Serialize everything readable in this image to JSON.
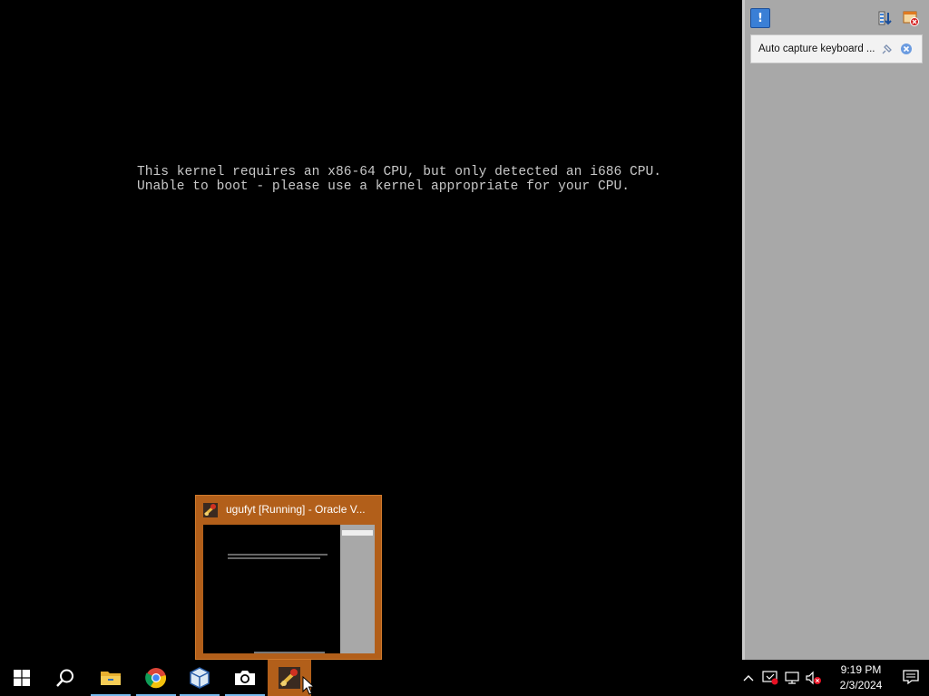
{
  "console": {
    "line1": "This kernel requires an x86-64 CPU, but only detected an i686 CPU.",
    "line2": "Unable to boot - please use a kernel appropriate for your CPU."
  },
  "side_panel": {
    "icons": [
      "info-icon",
      "collapse-all-icon",
      "close-all-icon"
    ],
    "notification": {
      "text": "Auto capture keyboard ...",
      "icons": [
        "pin-icon",
        "close-icon"
      ]
    }
  },
  "preview": {
    "title": "ugufyt [Running] - Oracle V...",
    "icon": "virtualbox-vm-icon"
  },
  "taskbar": {
    "buttons": [
      {
        "name": "start",
        "icon": "windows-logo-icon"
      },
      {
        "name": "search",
        "icon": "search-icon"
      },
      {
        "name": "file-explorer",
        "icon": "folder-icon"
      },
      {
        "name": "chrome",
        "icon": "chrome-icon"
      },
      {
        "name": "virtualbox",
        "icon": "virtualbox-icon"
      },
      {
        "name": "camera",
        "icon": "camera-icon"
      },
      {
        "name": "vm-window",
        "icon": "virtualbox-vm-icon"
      }
    ],
    "active_color": "#b25f1a",
    "tray": {
      "icons": [
        "chevron-up-icon",
        "security-shield-icon",
        "network-icon",
        "volume-muted-icon",
        "notification-icon"
      ],
      "time": "9:19 PM",
      "date": "2/3/2024"
    }
  }
}
